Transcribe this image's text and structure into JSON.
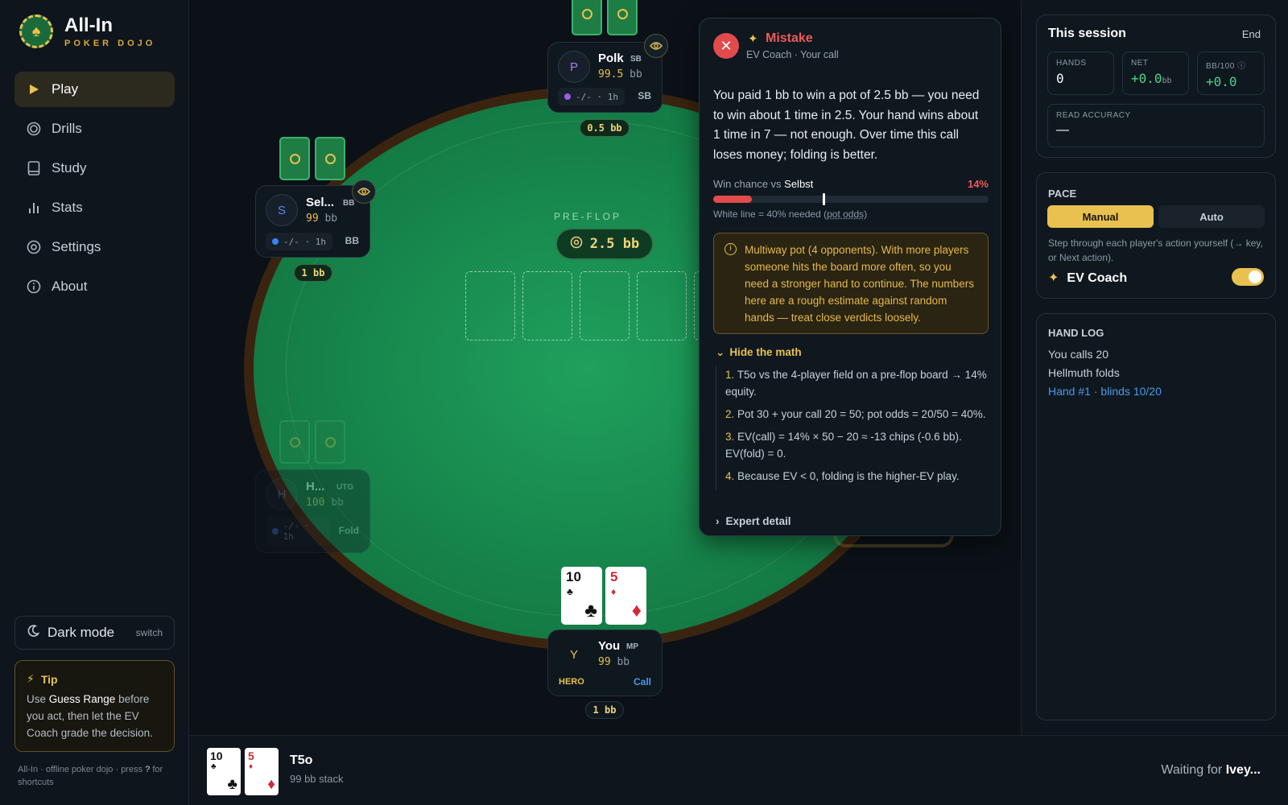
{
  "brand": {
    "title": "All-In",
    "subtitle": "POKER DOJO"
  },
  "nav": [
    {
      "label": "Play",
      "icon": "play-icon",
      "active": true
    },
    {
      "label": "Drills",
      "icon": "target-icon"
    },
    {
      "label": "Study",
      "icon": "book-icon"
    },
    {
      "label": "Stats",
      "icon": "bar-chart-icon"
    },
    {
      "label": "Settings",
      "icon": "gear-icon"
    },
    {
      "label": "About",
      "icon": "info-icon"
    }
  ],
  "darkmode": {
    "label": "Dark mode",
    "hint": "switch"
  },
  "tip": {
    "title": "Tip",
    "pre": "Use ",
    "highlight": "Guess Range",
    "post": " before you act, then let the EV Coach grade the decision."
  },
  "footer": {
    "text": "All-In · offline poker dojo · press ",
    "key": "?",
    "post": " for shortcuts"
  },
  "table": {
    "street": "PRE-FLOP",
    "pot": "2.5 bb",
    "board_slots": 5,
    "seats": {
      "polk": {
        "initial": "P",
        "name": "Polk",
        "pos": "SB",
        "stack": "99.5",
        "unit": "bb",
        "read": "-/- · 1h",
        "action": "SB",
        "bet": "0.5 bb",
        "dot": "#9b5de5"
      },
      "selbst": {
        "initial": "S",
        "name": "Sel...",
        "pos": "BB",
        "stack": "99",
        "unit": "bb",
        "read": "-/- · 1h",
        "action": "BB",
        "bet": "1 bb",
        "dot": "#3b82f6"
      },
      "hellmuth": {
        "initial": "H",
        "name": "H...",
        "pos": "UTG",
        "stack": "100",
        "unit": "bb",
        "read": "-/- · 1h",
        "action": "Fold",
        "dot": "#3b82f6"
      },
      "hero": {
        "initial": "Y",
        "name": "You",
        "pos": "MP",
        "stack": "99",
        "unit": "bb",
        "tag": "HERO",
        "action": "Call",
        "bet": "1 bb"
      }
    },
    "hero_cards": [
      {
        "rank": "10",
        "suit": "♣",
        "color": "blk"
      },
      {
        "rank": "5",
        "suit": "♦",
        "color": "red"
      }
    ]
  },
  "coach": {
    "title": "Mistake",
    "subtitle": "EV Coach · Your call",
    "body": "You paid 1 bb to win a pot of 2.5 bb — you need to win about 1 time in 2.5. Your hand wins about 1 time in 7 — not enough. Over time this call loses money; folding is better.",
    "win_label": "Win chance vs ",
    "win_vs": "Selbst",
    "win_pct": "14%",
    "win_value": 0.14,
    "needed_value": 0.4,
    "note_pre": "White line = 40% needed (",
    "note_link": "pot odds",
    "note_post": ")",
    "warning": "Multiway pot (4 opponents). With more players someone hits the board more often, so you need a stronger hand to continue. The numbers here are a rough estimate against random hands — treat close verdicts loosely.",
    "hide_math": "Hide the math",
    "steps": [
      {
        "n": "1.",
        "text": "T5o vs the 4-player field on a pre-flop board → 14% equity."
      },
      {
        "n": "2.",
        "text": "Pot 30 + your call 20 = 50; pot odds = 20/50 = 40%."
      },
      {
        "n": "3.",
        "text": "EV(call) = 14% × 50 − 20 ≈ -13 chips (-0.6 bb). EV(fold) = 0."
      },
      {
        "n": "4.",
        "text": "Because EV < 0, folding is the higher-EV play."
      }
    ],
    "expert": "Expert detail"
  },
  "session": {
    "title": "This session",
    "end": "End",
    "hands_label": "HANDS",
    "hands": "0",
    "net_label": "NET",
    "net": "+0.0",
    "net_unit": "bb",
    "bb100_label": "BB/100",
    "bb100": "+0.0",
    "acc_label": "READ ACCURACY",
    "acc": "—"
  },
  "pace": {
    "title": "PACE",
    "manual": "Manual",
    "auto": "Auto",
    "desc": "Step through each player's action yourself (→ key, or Next action).",
    "coach_label": "EV Coach",
    "coach_on": true
  },
  "log": {
    "title": "HAND LOG",
    "items": [
      "You calls 20",
      "Hellmuth folds"
    ],
    "hand": "Hand #1 · blinds 10/20"
  },
  "bottom": {
    "hand": "T5o",
    "stack": "99 bb stack",
    "waiting": "Waiting for ",
    "waiting_name": "Ivey..."
  },
  "colors": {
    "accent": "#e8c150",
    "felt": "#16834a",
    "mistake": "#e14b4b",
    "positive": "#4cd38a",
    "link": "#4a9be8"
  }
}
